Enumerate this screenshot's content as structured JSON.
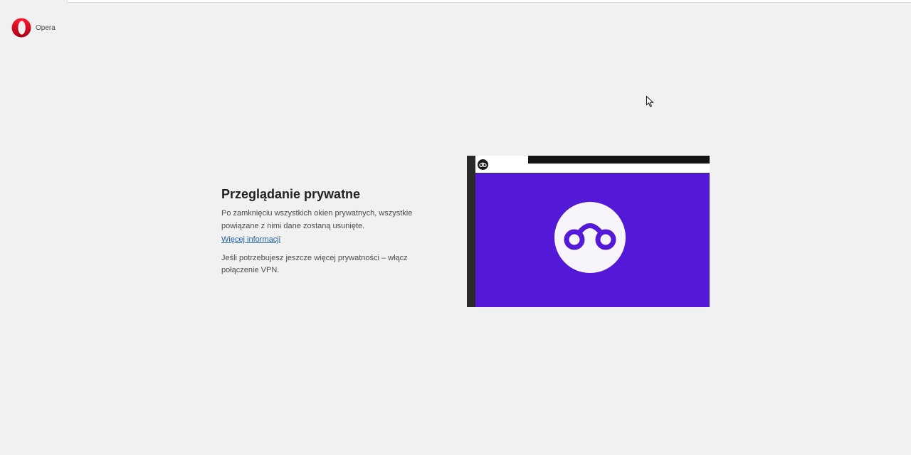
{
  "app": {
    "brand_name": "Opera"
  },
  "private_page": {
    "title": "Przeglądanie prywatne",
    "description": "Po zamknięciu wszystkich okien prywatnych, wszystkie powiązane z nimi dane zostaną usunięte.",
    "more_info_link": "Więcej informacji",
    "vpn_text": "Jeśli potrzebujesz jeszcze więcej prywatności – włącz połączenie VPN."
  },
  "illustration": {
    "panel_color": "#5318d8",
    "icon": "private-glasses-icon"
  },
  "colors": {
    "brand_red": "#d4121f",
    "link": "#1f5fa8",
    "background": "#f2f1f1"
  }
}
